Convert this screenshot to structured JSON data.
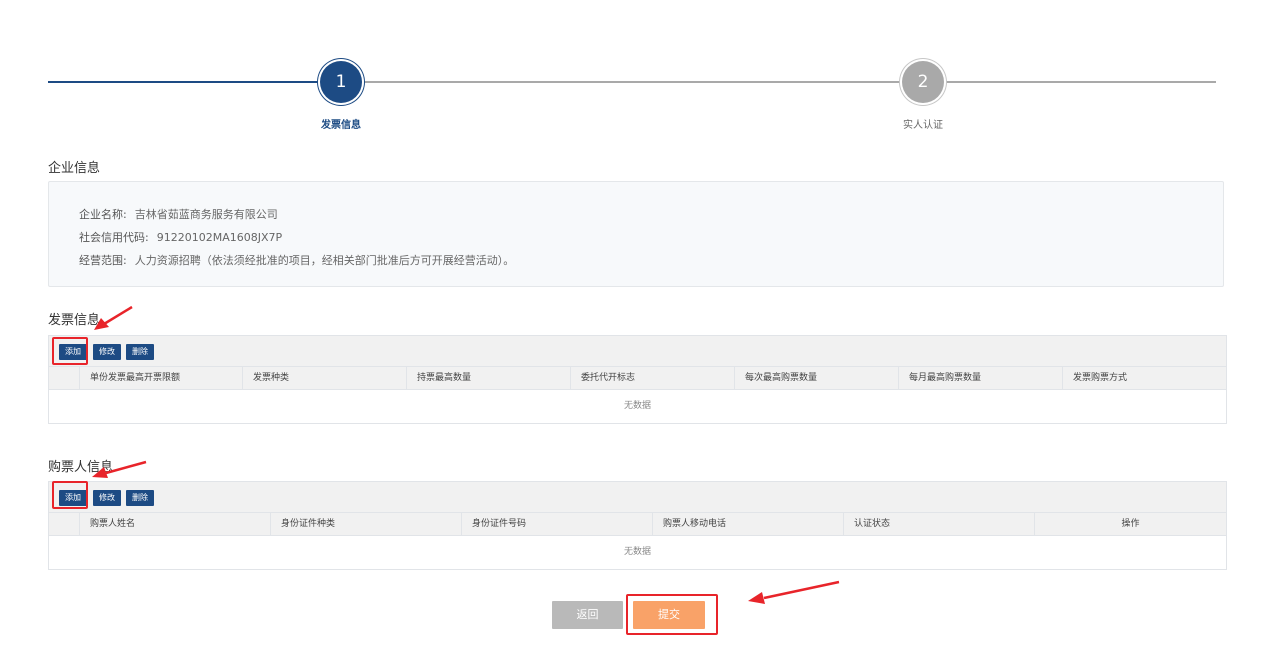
{
  "stepper": {
    "steps": [
      {
        "number": "1",
        "label": "发票信息"
      },
      {
        "number": "2",
        "label": "实人认证"
      }
    ]
  },
  "company": {
    "title": "企业信息",
    "fields": [
      {
        "key": "企业名称:",
        "value": "吉林省茹蓝商务服务有限公司"
      },
      {
        "key": "社会信用代码:",
        "value": "91220102MA1608JX7P"
      },
      {
        "key": "经营范围:",
        "value": "人力资源招聘（依法须经批准的项目，经相关部门批准后方可开展经营活动）。"
      }
    ]
  },
  "invoice": {
    "title": "发票信息",
    "buttons": {
      "add": "添加",
      "edit": "修改",
      "delete": "删除"
    },
    "columns": [
      "单份发票最高开票限额",
      "发票种类",
      "持票最高数量",
      "委托代开标志",
      "每次最高购票数量",
      "每月最高购票数量",
      "发票购票方式"
    ],
    "empty_text": "无数据"
  },
  "buyer": {
    "title": "购票人信息",
    "buttons": {
      "add": "添加",
      "edit": "修改",
      "delete": "删除"
    },
    "columns": [
      "购票人姓名",
      "身份证件种类",
      "身份证件号码",
      "购票人移动电话",
      "认证状态",
      "操作"
    ],
    "empty_text": "无数据"
  },
  "actions": {
    "back": "返回",
    "submit": "提交"
  },
  "colors": {
    "primary": "#1d4b84",
    "submit": "#f9a268",
    "back": "#b9b9b9",
    "annotation": "#e8242a"
  }
}
